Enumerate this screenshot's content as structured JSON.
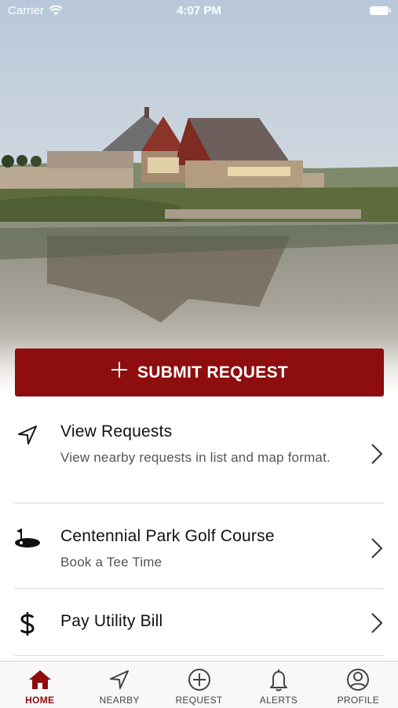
{
  "status_bar": {
    "carrier": "Carrier",
    "time": "4:07 PM"
  },
  "hero": {
    "image_icon": "golf-clubhouse-lake-photo"
  },
  "submit": {
    "icon": "plus-icon",
    "label": "SUBMIT REQUEST"
  },
  "menu": [
    {
      "icon": "navigation-arrow-icon",
      "title": "View Requests",
      "subtitle": "View nearby requests in list and map format."
    },
    {
      "icon": "golf-flag-icon",
      "title": "Centennial Park Golf Course",
      "subtitle": "Book a Tee Time"
    },
    {
      "icon": "dollar-icon",
      "title": "Pay Utility Bill",
      "subtitle": ""
    }
  ],
  "tabs": [
    {
      "icon": "home-icon",
      "label": "HOME",
      "active": true
    },
    {
      "icon": "navigation-arrow-icon",
      "label": "NEARBY",
      "active": false
    },
    {
      "icon": "plus-circle-icon",
      "label": "REQUEST",
      "active": false
    },
    {
      "icon": "bell-icon",
      "label": "ALERTS",
      "active": false
    },
    {
      "icon": "user-circle-icon",
      "label": "PROFILE",
      "active": false
    }
  ],
  "colors": {
    "accent": "#8e0d0f",
    "tab_active": "#8e0d0f",
    "tab_inactive": "#444444"
  }
}
